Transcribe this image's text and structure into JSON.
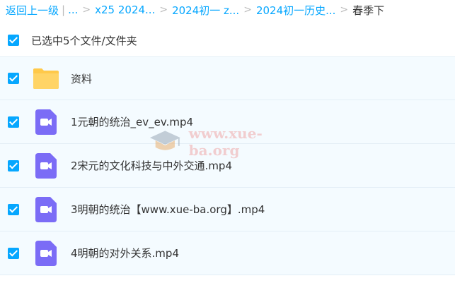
{
  "breadcrumb": {
    "back": "返回上一级",
    "pipe": "|",
    "ellipsis": "...",
    "items": [
      "x25 2024...",
      "2024初一 z...",
      "2024初一历史..."
    ],
    "separator": ">",
    "current": "春季下"
  },
  "selection": {
    "label": "已选中5个文件/文件夹"
  },
  "files": [
    {
      "name": "资料",
      "type": "folder"
    },
    {
      "name": "1元朝的统治_ev_ev.mp4",
      "type": "video"
    },
    {
      "name": "2宋元的文化科技与中外交通.mp4",
      "type": "video"
    },
    {
      "name": "3明朝的统治【www.xue-ba.org】.mp4",
      "type": "video"
    },
    {
      "name": "4明朝的对外关系.mp4",
      "type": "video"
    }
  ],
  "watermark": {
    "text": "www.xue-ba.org"
  },
  "colors": {
    "accent": "#06a7ff",
    "folder": "#ffc94a",
    "video": "#7b6cf6",
    "row_bg": "#f4fbff"
  },
  "icons": {
    "folder": "folder-icon",
    "video": "video-file-icon",
    "checkbox": "checkbox-checked-icon",
    "chevron": "chevron-right-icon"
  }
}
